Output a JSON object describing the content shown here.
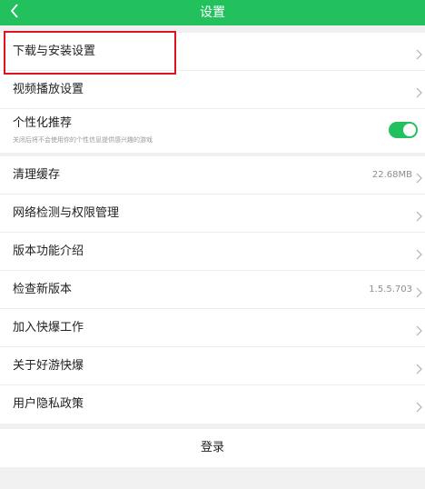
{
  "header": {
    "title": "设置",
    "back_icon": "chevron-left-icon",
    "background": "#22c15e"
  },
  "group1": {
    "items": [
      {
        "label": "下载与安装设置"
      },
      {
        "label": "视频播放设置"
      },
      {
        "label": "个性化推荐",
        "sublabel": "关闭后将不会使用你的个性信息提供感兴趣的游戏",
        "toggle_on": true
      }
    ]
  },
  "group2": {
    "items": [
      {
        "label": "清理缓存",
        "value": "22.68MB"
      },
      {
        "label": "网络检测与权限管理"
      },
      {
        "label": "版本功能介绍"
      },
      {
        "label": "检查新版本",
        "value": "1.5.5.703"
      },
      {
        "label": "加入快爆工作"
      },
      {
        "label": "关于好游快爆"
      },
      {
        "label": "用户隐私政策"
      }
    ]
  },
  "login": {
    "label": "登录"
  },
  "colors": {
    "accent": "#22c15e",
    "highlight": "#e0141e"
  }
}
